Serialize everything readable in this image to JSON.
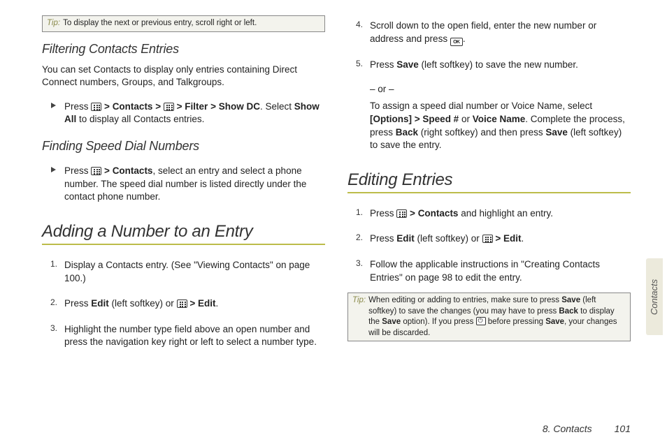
{
  "sideTab": "Contacts",
  "footer": {
    "chapter": "8. Contacts",
    "page": "101"
  },
  "left": {
    "tip1_label": "Tip:",
    "tip1_body": "To display the next or previous entry, scroll right or left.",
    "h_filter": "Filtering Contacts Entries",
    "p_filter": "You can set Contacts to display only entries containing Direct Connect numbers, Groups, and Talkgroups.",
    "filter_step_pre": "Press ",
    "filter_step_a": "Contacts",
    "filter_step_b": "Filter",
    "filter_step_c": "Show DC",
    "filter_step_post1": ". Select ",
    "filter_step_d": "Show All",
    "filter_step_post2": " to display all Contacts entries.",
    "h_speed": "Finding Speed Dial Numbers",
    "speed_pre": "Press ",
    "speed_a": "Contacts",
    "speed_post": ", select an entry and select a phone number. The speed dial number is listed directly under the contact phone number.",
    "h_add": "Adding a Number to an Entry",
    "add1": "Display a Contacts entry. (See \"Viewing Contacts\" on page 100.)",
    "add2_pre": "Press ",
    "add2_a": "Edit",
    "add2_mid": " (left softkey) or ",
    "add2_b": "Edit",
    "add2_post": ".",
    "add3": "Highlight the number type field above an open number and press the navigation key right or left to select a number type."
  },
  "right": {
    "r4_pre": "Scroll down to the open field, enter the new number or address and press ",
    "r4_post": ".",
    "r5_pre": "Press ",
    "r5_a": "Save",
    "r5_post": " (left softkey) to save the new number.",
    "or": "– or –",
    "r5b_pre": "To assign a speed dial number or Voice Name, select ",
    "r5b_a": "[Options]",
    "r5b_b": "Speed #",
    "r5b_mid": " or ",
    "r5b_c": "Voice Name",
    "r5b_d": ". Complete the process, press ",
    "r5b_e": "Back",
    "r5b_f": " (right softkey) and then press ",
    "r5b_g": "Save",
    "r5b_h": " (left softkey) to save the entry.",
    "h_edit": "Editing Entries",
    "e1_pre": "Press ",
    "e1_a": "Contacts",
    "e1_post": " and highlight an entry.",
    "e2_pre": "Press ",
    "e2_a": "Edit",
    "e2_mid": " (left softkey) or ",
    "e2_b": "Edit",
    "e2_post": ".",
    "e3": "Follow the applicable instructions in \"Creating Contacts Entries\" on page 98 to edit the entry.",
    "tip2_label": "Tip:",
    "tip2_a": "When editing or adding to entries, make sure to press ",
    "tip2_b": "Save",
    "tip2_c": " (left softkey) to save the changes (you may have to press ",
    "tip2_d": "Back",
    "tip2_e": " to display the ",
    "tip2_f": "Save",
    "tip2_g": " option). If you press ",
    "tip2_h": " before pressing ",
    "tip2_i": "Save",
    "tip2_j": ", your changes will be discarded."
  }
}
